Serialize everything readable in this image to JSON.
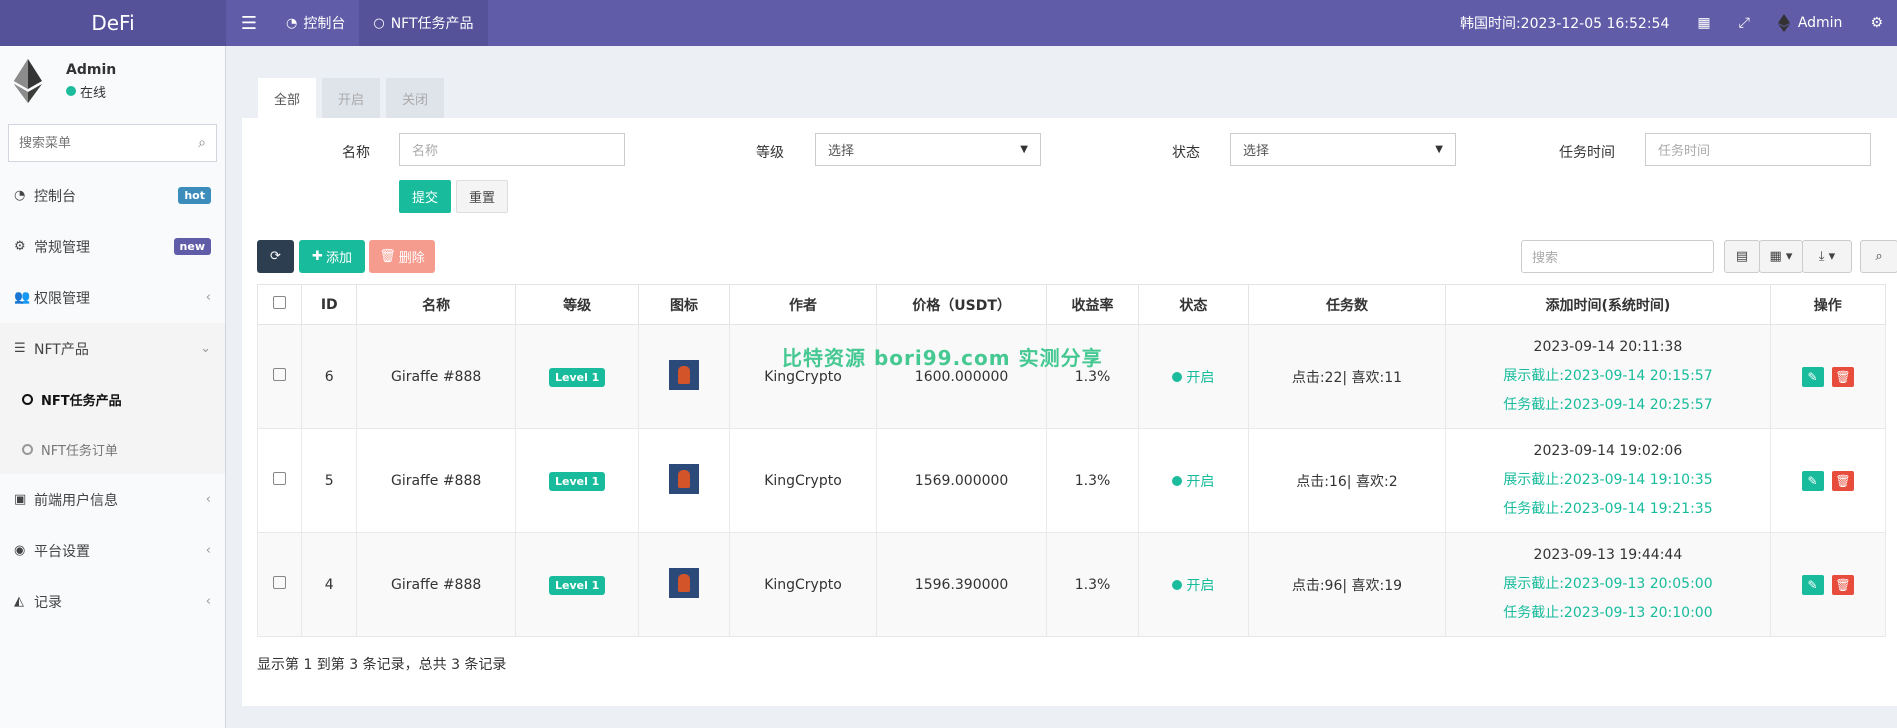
{
  "header": {
    "brand": "DeFi",
    "menu_toggle_icon": "bars-icon",
    "tabs": [
      {
        "label": "控制台",
        "icon": "dashboard-icon",
        "active": false
      },
      {
        "label": "NFT任务产品",
        "icon": "circle-icon",
        "active": true
      }
    ],
    "time_label": "韩国时间:2023-12-05 16:52:54",
    "admin_name": "Admin"
  },
  "sidebar": {
    "user_name": "Admin",
    "user_status": "在线",
    "search_placeholder": "搜索菜单",
    "items": [
      {
        "label": "控制台",
        "badge": "hot"
      },
      {
        "label": "常规管理",
        "badge": "new"
      },
      {
        "label": "权限管理"
      },
      {
        "label": "NFT产品"
      },
      {
        "label": "前端用户信息"
      },
      {
        "label": "平台设置"
      },
      {
        "label": "记录"
      }
    ],
    "sub_items": [
      {
        "label": "NFT任务产品",
        "active": true
      },
      {
        "label": "NFT任务订单",
        "active": false
      }
    ]
  },
  "content": {
    "tabs": [
      "全部",
      "开启",
      "关闭"
    ],
    "filters": {
      "name_label": "名称",
      "name_placeholder": "名称",
      "level_label": "等级",
      "level_value": "选择",
      "status_label": "状态",
      "status_value": "选择",
      "time_label": "任务时间",
      "time_placeholder": "任务时间",
      "submit": "提交",
      "reset": "重置"
    },
    "toolbar": {
      "add": "添加",
      "delete": "删除",
      "search_placeholder": "搜索"
    },
    "columns": [
      "ID",
      "名称",
      "等级",
      "图标",
      "作者",
      "价格（USDT）",
      "收益率",
      "状态",
      "任务数",
      "添加时间(系统时间)",
      "操作"
    ],
    "rows": [
      {
        "id": "6",
        "name": "Giraffe #888",
        "level": "Level 1",
        "author": "KingCrypto",
        "price": "1600.000000",
        "rate": "1.3%",
        "status": "开启",
        "tasks": "点击:22| 喜欢:11",
        "added": "2023-09-14 20:11:38",
        "show_until": "展示截止:2023-09-14 20:15:57",
        "task_until": "任务截止:2023-09-14 20:25:57"
      },
      {
        "id": "5",
        "name": "Giraffe #888",
        "level": "Level 1",
        "author": "KingCrypto",
        "price": "1569.000000",
        "rate": "1.3%",
        "status": "开启",
        "tasks": "点击:16| 喜欢:2",
        "added": "2023-09-14 19:02:06",
        "show_until": "展示截止:2023-09-14 19:10:35",
        "task_until": "任务截止:2023-09-14 19:21:35"
      },
      {
        "id": "4",
        "name": "Giraffe #888",
        "level": "Level 1",
        "author": "KingCrypto",
        "price": "1596.390000",
        "rate": "1.3%",
        "status": "开启",
        "tasks": "点击:96| 喜欢:19",
        "added": "2023-09-13 19:44:44",
        "show_until": "展示截止:2023-09-13 20:05:00",
        "task_until": "任务截止:2023-09-13 20:10:00"
      }
    ],
    "pagination_info": "显示第 1 到第 3 条记录，总共 3 条记录",
    "watermark": "比特资源 bori99.com 实测分享"
  }
}
